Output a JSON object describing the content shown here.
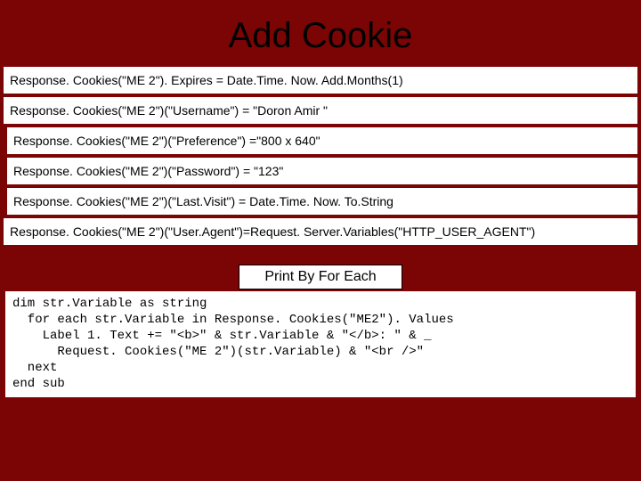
{
  "title": "Add Cookie",
  "lines": [
    "Response. Cookies(\"ME 2\"). Expires = Date.Time. Now. Add.Months(1)",
    "Response. Cookies(\"ME 2\")(\"Username\") = \"Doron Amir \"",
    "Response. Cookies(\"ME 2\")(\"Preference\") =\"800 x 640\"",
    "Response. Cookies(\"ME 2\")(\"Password\") = \"123\"",
    "Response. Cookies(\"ME 2\")(\"Last.Visit\") = Date.Time. Now. To.String",
    "Response. Cookies(\"ME 2\")(\"User.Agent\")=Request. Server.Variables(\"HTTP_USER_AGENT\")"
  ],
  "caption": "Print By For Each",
  "snippet": "dim str.Variable as string\n  for each str.Variable in Response. Cookies(\"ME2\"). Values\n    Label 1. Text += \"<b>\" & str.Variable & \"</b>: \" & _\n      Request. Cookies(\"ME 2\")(str.Variable) & \"<br />\"\n  next\nend sub"
}
